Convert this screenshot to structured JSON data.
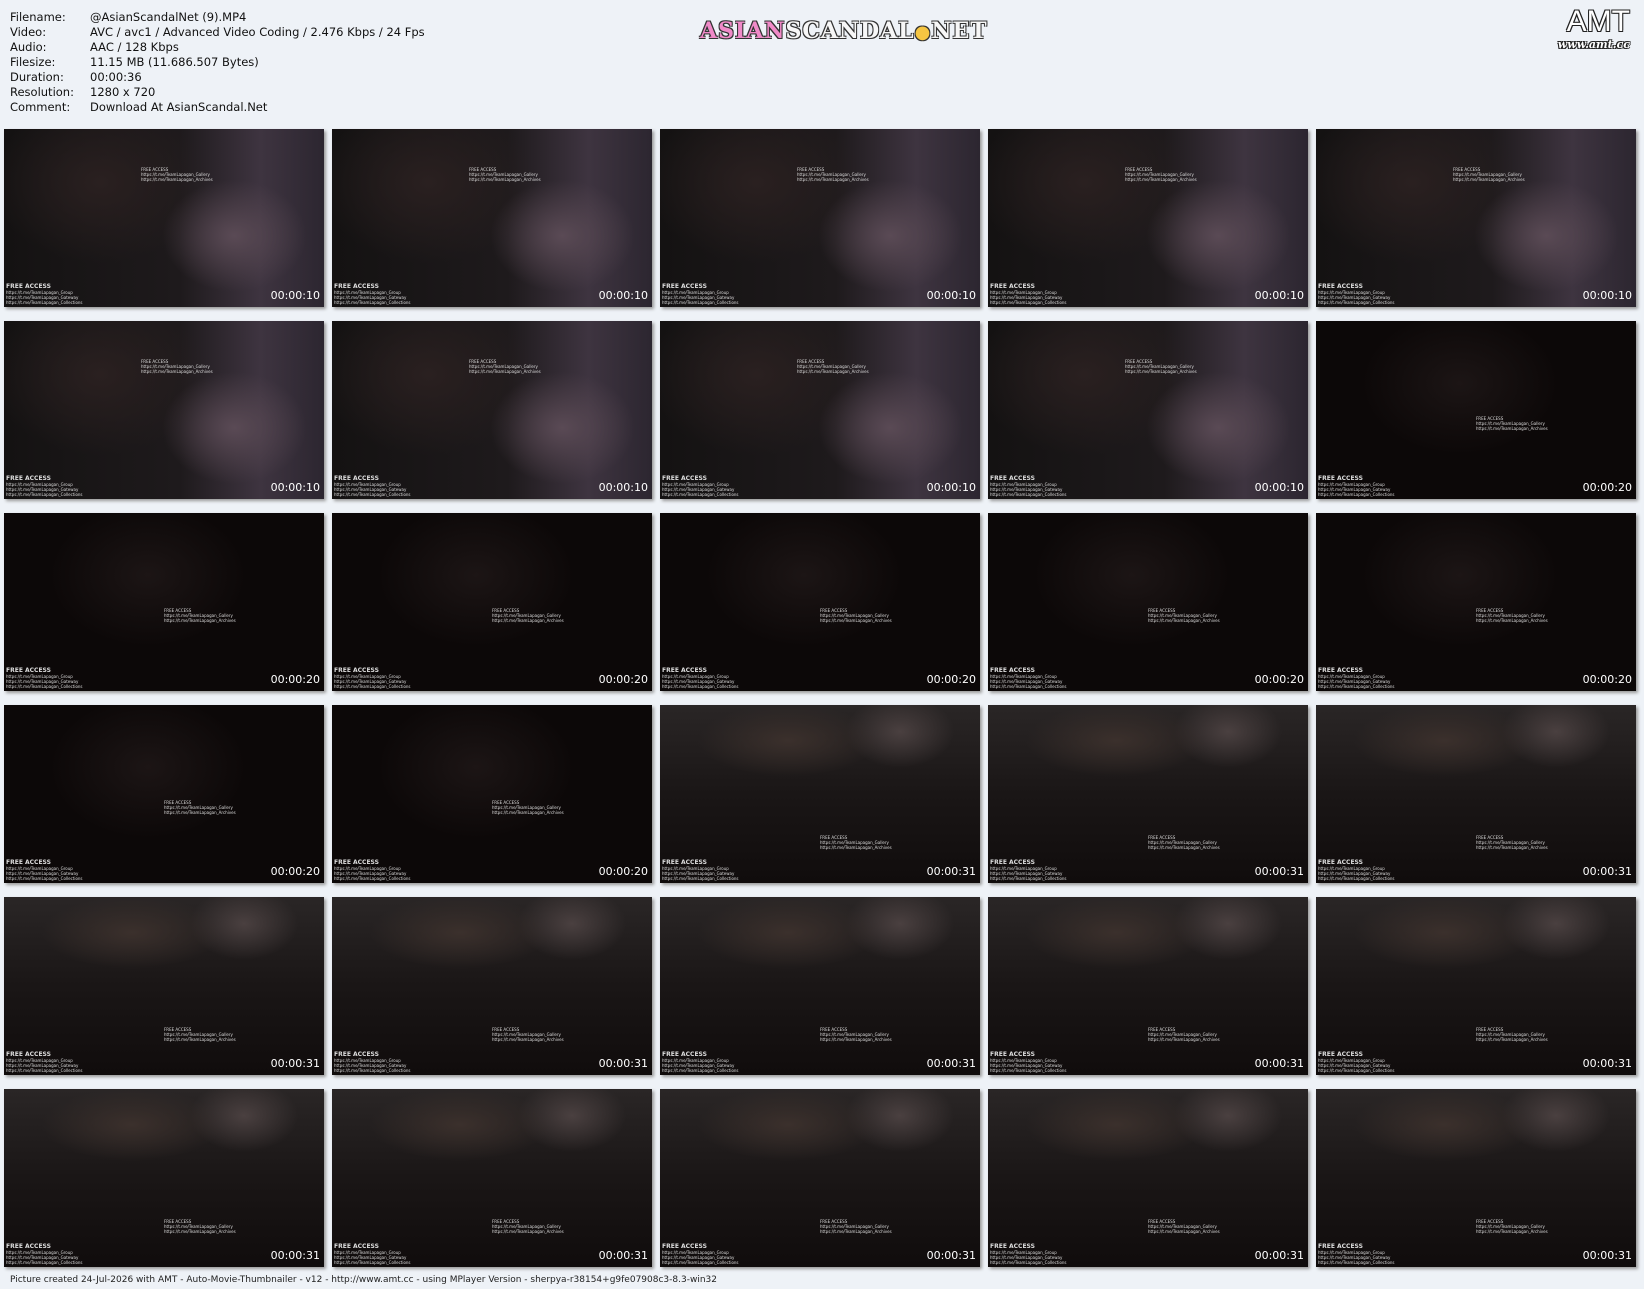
{
  "info": [
    {
      "label": "Filename:",
      "value": "@AsianScandalNet (9).MP4"
    },
    {
      "label": "Video:",
      "value": "AVC / avc1 / Advanced Video Coding / 2.476 Kbps / 24 Fps"
    },
    {
      "label": "Audio:",
      "value": "AAC / 128 Kbps"
    },
    {
      "label": "Filesize:",
      "value": "11.15 MB (11.686.507 Bytes)"
    },
    {
      "label": "Duration:",
      "value": "00:00:36"
    },
    {
      "label": "Resolution:",
      "value": "1280 x 720"
    },
    {
      "label": "Comment:",
      "value": "Download At AsianScandal.Net"
    }
  ],
  "banner": {
    "part1": "ASIAN",
    "part2": "SCANDAL",
    "dot": "●",
    "part3": "NET"
  },
  "amt": {
    "big": "AMT",
    "small": "www.amt.cc"
  },
  "watermark": {
    "mid": [
      "FREE ACCESS",
      "https://t.me/TeamLapagan_Gallery",
      "https://t.me/TeamLapagan_Archives"
    ],
    "bottom_title": "FREE ACCESS",
    "bottom": [
      "https://t.me/TeamLapagan_Group",
      "https://t.me/TeamLapagan_Gateway",
      "https://t.me/TeamLapagan_Collections"
    ]
  },
  "thumbs": [
    {
      "ts": "00:00:10",
      "scene": "a"
    },
    {
      "ts": "00:00:10",
      "scene": "a"
    },
    {
      "ts": "00:00:10",
      "scene": "a"
    },
    {
      "ts": "00:00:10",
      "scene": "a"
    },
    {
      "ts": "00:00:10",
      "scene": "a"
    },
    {
      "ts": "00:00:10",
      "scene": "a"
    },
    {
      "ts": "00:00:10",
      "scene": "a"
    },
    {
      "ts": "00:00:10",
      "scene": "a"
    },
    {
      "ts": "00:00:10",
      "scene": "a"
    },
    {
      "ts": "00:00:20",
      "scene": "b"
    },
    {
      "ts": "00:00:20",
      "scene": "b"
    },
    {
      "ts": "00:00:20",
      "scene": "b"
    },
    {
      "ts": "00:00:20",
      "scene": "b"
    },
    {
      "ts": "00:00:20",
      "scene": "b"
    },
    {
      "ts": "00:00:20",
      "scene": "b"
    },
    {
      "ts": "00:00:20",
      "scene": "b"
    },
    {
      "ts": "00:00:20",
      "scene": "b"
    },
    {
      "ts": "00:00:31",
      "scene": "c"
    },
    {
      "ts": "00:00:31",
      "scene": "c"
    },
    {
      "ts": "00:00:31",
      "scene": "c"
    },
    {
      "ts": "00:00:31",
      "scene": "c"
    },
    {
      "ts": "00:00:31",
      "scene": "c"
    },
    {
      "ts": "00:00:31",
      "scene": "c"
    },
    {
      "ts": "00:00:31",
      "scene": "c"
    },
    {
      "ts": "00:00:31",
      "scene": "c"
    },
    {
      "ts": "00:00:31",
      "scene": "c"
    },
    {
      "ts": "00:00:31",
      "scene": "c"
    },
    {
      "ts": "00:00:31",
      "scene": "c"
    },
    {
      "ts": "00:00:31",
      "scene": "c"
    },
    {
      "ts": "00:00:31",
      "scene": "c"
    }
  ],
  "footer": "Picture created 24-Jul-2026 with AMT - Auto-Movie-Thumbnailer - v12 - http://www.amt.cc - using MPlayer Version - sherpya-r38154+g9fe07908c3-8.3-win32"
}
